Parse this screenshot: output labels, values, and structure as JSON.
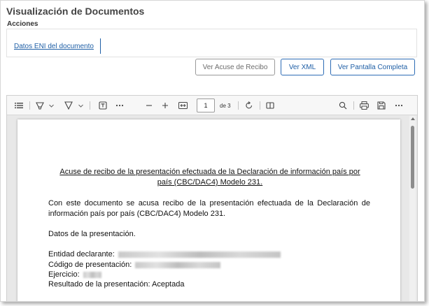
{
  "header": {
    "title": "Visualización de Documentos",
    "section": "Acciones"
  },
  "actions": {
    "link_eni": "Datos ENI del documento"
  },
  "buttons": {
    "acuse": "Ver Acuse de Recibo",
    "xml": "Ver XML",
    "full": "Ver Pantalla Completa"
  },
  "viewer": {
    "page_number": "1",
    "page_total": "de 3",
    "icons": [
      "list-icon",
      "highlighter-icon",
      "chevron-down-icon",
      "filter-pen-icon",
      "chevron-down-icon",
      "text-box-icon",
      "more-icon",
      "zoom-out-icon",
      "zoom-in-icon",
      "fit-width-icon",
      "rotate-icon",
      "page-view-icon",
      "search-icon",
      "print-icon",
      "save-icon",
      "more-icon"
    ]
  },
  "document": {
    "heading": "Acuse de recibo de la presentación efectuada de la Declaración de información país por país (CBC/DAC4) Modelo 231.",
    "intro": "Con este documento se acusa recibo de la presentación efectuada de la Declaración de información país por país (CBC/DAC4) Modelo 231.",
    "data_label": "Datos de la presentación.",
    "entidad_label": "Entidad declarante:",
    "codigo_label": "Código de presentación:",
    "ejercicio_label": "Ejercicio:",
    "resultado": "Resultado de la presentación: Aceptada"
  },
  "colors": {
    "accent": "#1f5fa6",
    "disabled": "#6d6d6d"
  }
}
